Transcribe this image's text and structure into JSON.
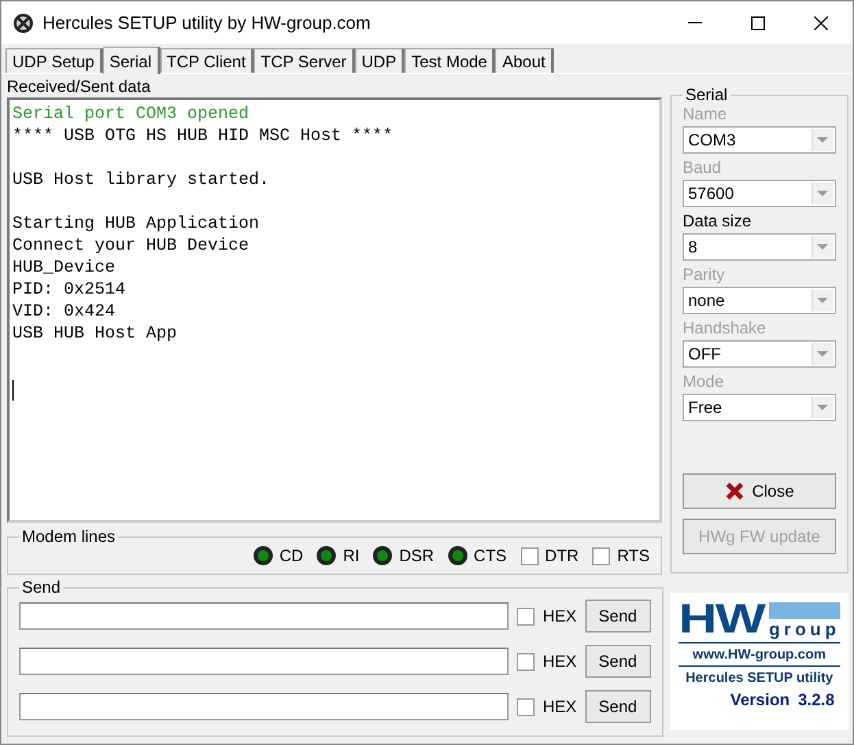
{
  "window": {
    "title": "Hercules SETUP utility by HW-group.com"
  },
  "tabs": [
    {
      "label": "UDP Setup",
      "selected": false
    },
    {
      "label": "Serial",
      "selected": true
    },
    {
      "label": "TCP Client",
      "selected": false
    },
    {
      "label": "TCP Server",
      "selected": false
    },
    {
      "label": "UDP",
      "selected": false
    },
    {
      "label": "Test Mode",
      "selected": false
    },
    {
      "label": "About",
      "selected": false
    }
  ],
  "received": {
    "title": "Received/Sent data",
    "lines": [
      {
        "kind": "status",
        "text": "Serial port COM3 opened"
      },
      {
        "kind": "text",
        "text": "**** USB OTG HS HUB HID MSC Host ****"
      },
      {
        "kind": "blank"
      },
      {
        "kind": "text",
        "text": "USB Host library started."
      },
      {
        "kind": "blank"
      },
      {
        "kind": "text",
        "text": "Starting HUB Application"
      },
      {
        "kind": "text",
        "text": "Connect your HUB Device"
      },
      {
        "kind": "text",
        "text": "HUB_Device"
      },
      {
        "kind": "text",
        "text": "PID: 0x2514"
      },
      {
        "kind": "text",
        "text": "VID: 0x424"
      },
      {
        "kind": "text",
        "text": "USB HUB Host App"
      }
    ]
  },
  "modem_lines": {
    "title": "Modem lines",
    "items": [
      {
        "kind": "led",
        "label": "CD",
        "on": true
      },
      {
        "kind": "led",
        "label": "RI",
        "on": true
      },
      {
        "kind": "led",
        "label": "DSR",
        "on": true
      },
      {
        "kind": "led",
        "label": "CTS",
        "on": true
      },
      {
        "kind": "checkbox",
        "label": "DTR",
        "checked": false
      },
      {
        "kind": "checkbox",
        "label": "RTS",
        "checked": false
      }
    ]
  },
  "send": {
    "title": "Send",
    "rows": [
      {
        "hex_label": "HEX",
        "hex": false,
        "button": "Send"
      },
      {
        "hex_label": "HEX",
        "hex": false,
        "button": "Send"
      },
      {
        "hex_label": "HEX",
        "hex": false,
        "button": "Send"
      }
    ]
  },
  "serial": {
    "title": "Serial",
    "fields": [
      {
        "label": "Name",
        "value": "COM3",
        "disabled": true
      },
      {
        "label": "Baud",
        "value": "57600",
        "disabled": true
      },
      {
        "label": "Data size",
        "value": "8",
        "disabled": false
      },
      {
        "label": "Parity",
        "value": "none",
        "disabled": true
      },
      {
        "label": "Handshake",
        "value": "OFF",
        "disabled": true
      },
      {
        "label": "Mode",
        "value": "Free",
        "disabled": true
      }
    ],
    "buttons": [
      {
        "label": "Close",
        "kind": "close",
        "disabled": false
      },
      {
        "label": "HWg FW update",
        "kind": "plain",
        "disabled": true
      }
    ]
  },
  "logo": {
    "mark": "HW",
    "group": "group",
    "url": "www.HW-group.com",
    "product": "Hercules SETUP utility",
    "version_label": "Version",
    "version": "3.2.8"
  }
}
